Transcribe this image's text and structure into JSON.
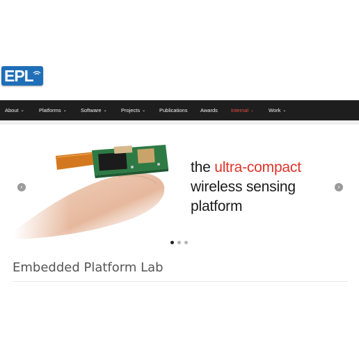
{
  "logo": {
    "text": "EPL"
  },
  "nav": {
    "items": [
      {
        "label": "About",
        "dropdown": true
      },
      {
        "label": "Platforms",
        "dropdown": true
      },
      {
        "label": "Software",
        "dropdown": true
      },
      {
        "label": "Projects",
        "dropdown": true
      },
      {
        "label": "Publications",
        "dropdown": false
      },
      {
        "label": "Awards",
        "dropdown": false
      },
      {
        "label": "Internal",
        "dropdown": true,
        "active": true
      },
      {
        "label": "Work",
        "dropdown": true
      }
    ],
    "caret": "⌄",
    "background": "#1e1e1e",
    "active_color": "#e8503f"
  },
  "slider": {
    "tagline": {
      "pre": "the ",
      "highlight": "ultra-compact",
      "line2": "wireless sensing",
      "line3": "platform"
    },
    "highlight_color": "#e03228",
    "prev_icon": "‹",
    "next_icon": "›",
    "slide_count": 3,
    "active_slide": 1
  },
  "site": {
    "title": "Embedded Platform Lab"
  }
}
